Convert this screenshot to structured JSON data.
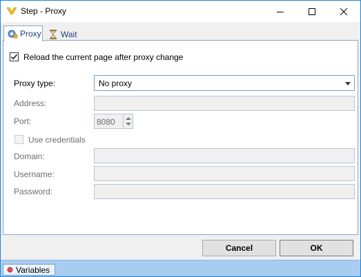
{
  "window": {
    "title": "Step - Proxy"
  },
  "tabs": [
    {
      "label": "Proxy",
      "icon": "gear-icon",
      "active": true
    },
    {
      "label": "Wait",
      "icon": "hourglass-icon",
      "active": false
    }
  ],
  "form": {
    "reload_checkbox": {
      "label": "Reload the current page after proxy change",
      "checked": true
    },
    "proxy_type": {
      "label": "Proxy type:",
      "value": "No proxy"
    },
    "address": {
      "label": "Address:",
      "value": ""
    },
    "port": {
      "label": "Port:",
      "value": "8080"
    },
    "use_credentials": {
      "label": "Use credentials",
      "checked": false
    },
    "domain": {
      "label": "Domain:",
      "value": ""
    },
    "username": {
      "label": "Username:",
      "value": ""
    },
    "password": {
      "label": "Password:",
      "value": ""
    }
  },
  "buttons": {
    "cancel": "Cancel",
    "ok": "OK"
  },
  "statusbar": {
    "variables_tab": "Variables"
  }
}
